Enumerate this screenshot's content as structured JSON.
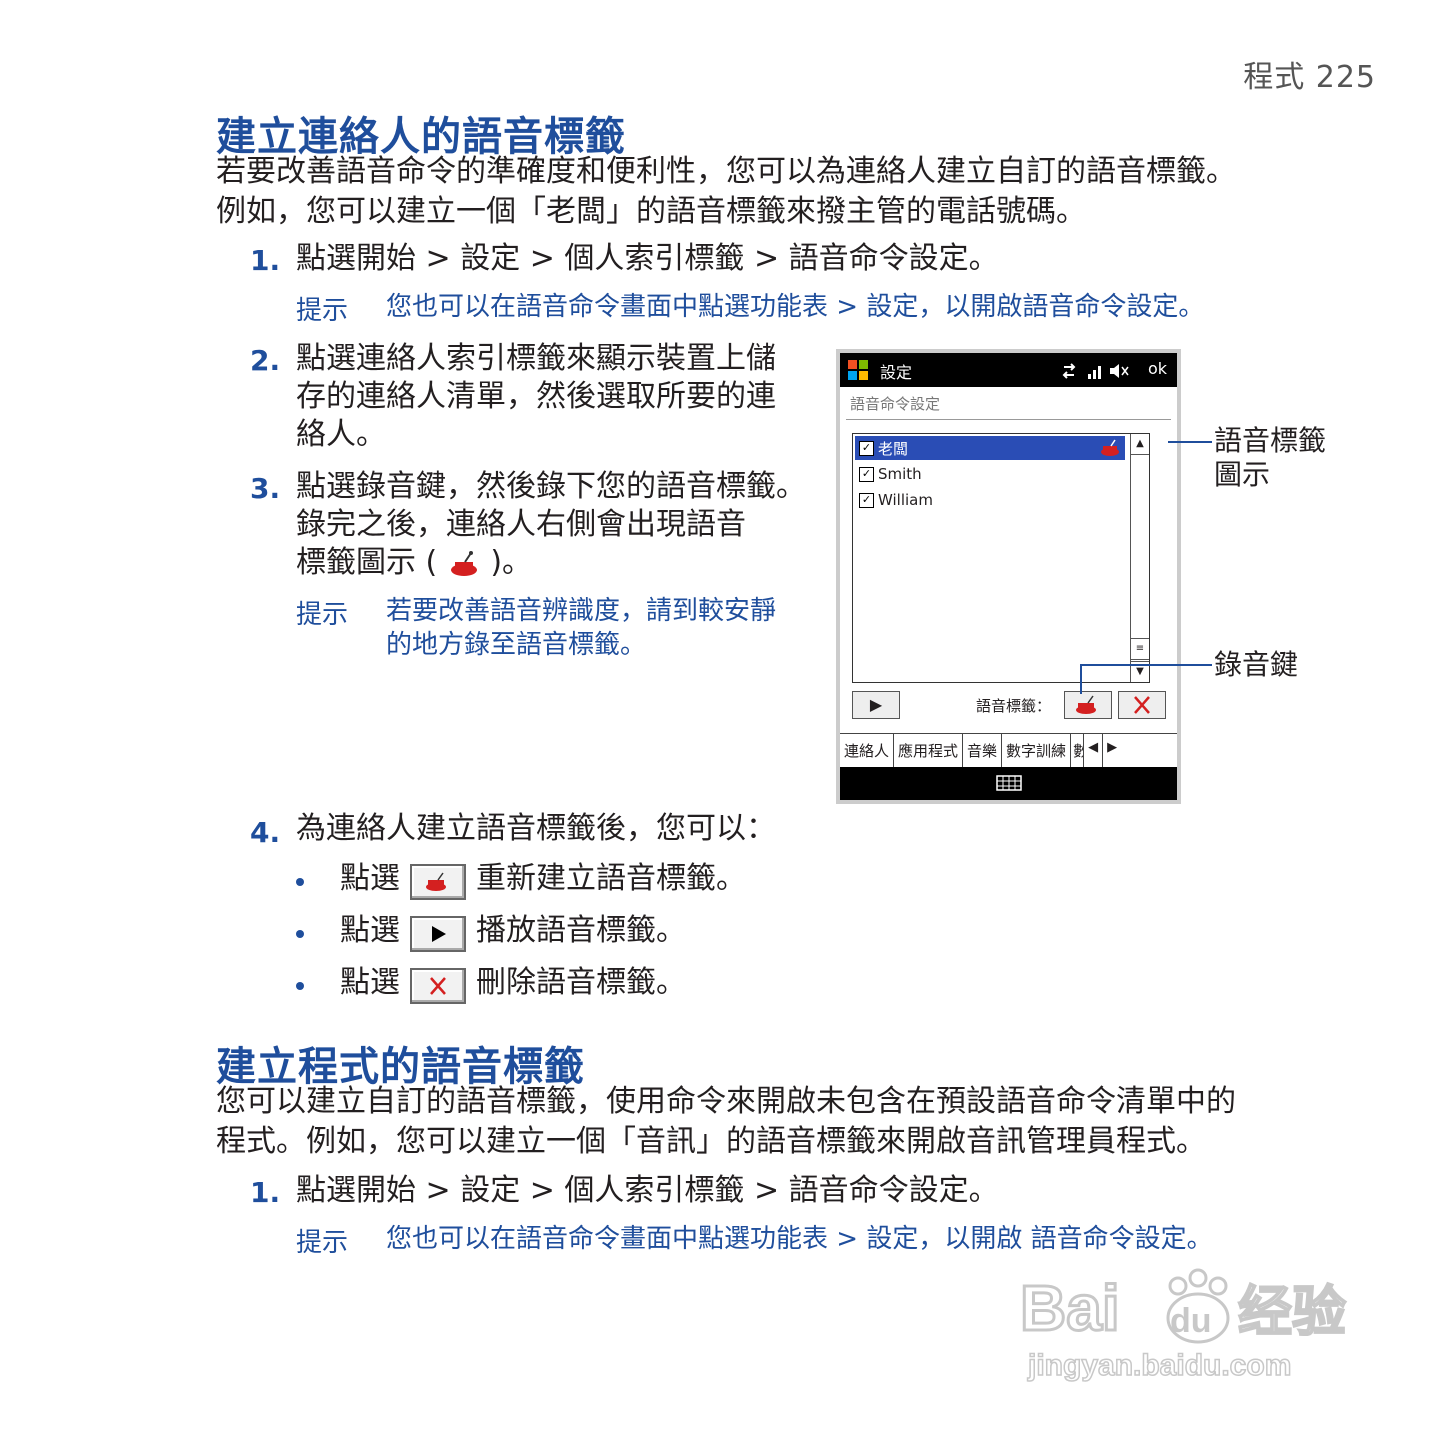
{
  "header": {
    "page_label": "程式  225"
  },
  "section1": {
    "title": "建立連絡人的語音標籤",
    "intro_line1": "若要改善語音命令的準確度和便利性，您可以為連絡人建立自訂的語音標籤。",
    "intro_line2": "例如，您可以建立一個「老闆」的語音標籤來撥主管的電話號碼。",
    "step1_num": "1.",
    "step1_text": "點選開始 > 設定 > 個人索引標籤 > 語音命令設定。",
    "tip1_label": "提示",
    "tip1_text": "您也可以在語音命令畫面中點選功能表 > 設定，以開啟語音命令設定。",
    "step2_num": "2.",
    "step2_line1": "點選連絡人索引標籤來顯示裝置上儲",
    "step2_line2": "存的連絡人清單，然後選取所要的連",
    "step2_line3": "絡人。",
    "step3_num": "3.",
    "step3_line1": "點選錄音鍵，然後錄下您的語音標籤。",
    "step3_line2": "錄完之後，連絡人右側會出現語音",
    "step3_line3a": "標籤圖示 (",
    "step3_line3b": ")。",
    "tip2_label": "提示",
    "tip2_line1": "若要改善語音辨識度，請到較安靜",
    "tip2_line2": "的地方錄至語音標籤。",
    "step4_num": "4.",
    "step4_text": "為連絡人建立語音標籤後，您可以：",
    "bullets": [
      {
        "prefix": "點選",
        "text": "重新建立語音標籤。"
      },
      {
        "prefix": "點選",
        "text": "播放語音標籤。"
      },
      {
        "prefix": "點選",
        "text": "刪除語音標籤。"
      }
    ]
  },
  "phone": {
    "title": "設定",
    "ok": "ok",
    "subtitle": "語音命令設定",
    "contacts": [
      {
        "name": "老闆",
        "checked": true,
        "selected": true
      },
      {
        "name": "Smith",
        "checked": true,
        "selected": false
      },
      {
        "name": "William",
        "checked": true,
        "selected": false
      }
    ],
    "voice_tag_label": "語音標籤：",
    "tabs": [
      "連絡人",
      "應用程式",
      "音樂",
      "數字訓練",
      "數"
    ]
  },
  "callouts": {
    "voice_tag_icon_line1": "語音標籤",
    "voice_tag_icon_line2": "圖示",
    "record_key": "錄音鍵"
  },
  "section2": {
    "title": "建立程式的語音標籤",
    "intro_line1": "您可以建立自訂的語音標籤，使用命令來開啟未包含在預設語音命令清單中的",
    "intro_line2": "程式。例如，您可以建立一個「音訊」的語音標籤來開啟音訊管理員程式。",
    "step1_num": "1.",
    "step1_text": "點選開始 > 設定 > 個人索引標籤 > 語音命令設定。",
    "tip_label": "提示",
    "tip_text": "您也可以在語音命令畫面中點選功能表 > 設定，以開啟 語音命令設定。"
  },
  "watermark": {
    "brand": "Baidu经验",
    "url": "jingyan.baidu.com"
  },
  "colors": {
    "accent": "#1f4e9c",
    "select": "#2a4db5",
    "delete_x": "#d42020"
  }
}
